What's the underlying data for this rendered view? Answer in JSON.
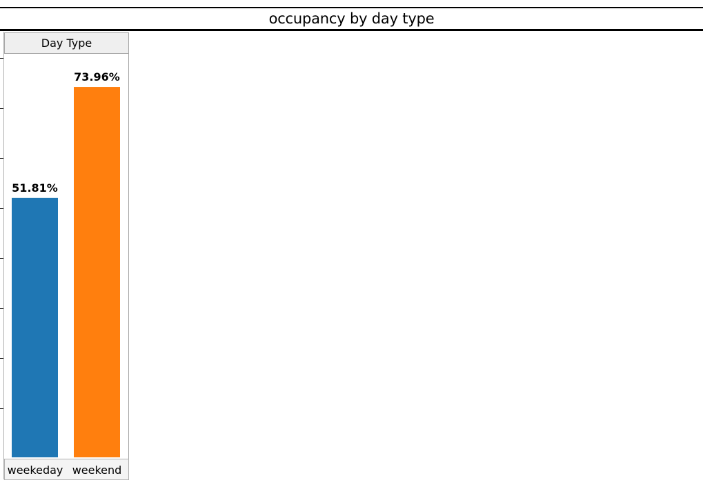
{
  "chart_data": {
    "type": "bar",
    "title": "occupancy by day type",
    "column_header": "Day Type",
    "categories": [
      "weekeday",
      "weekend"
    ],
    "values": [
      51.81,
      73.96
    ],
    "value_labels": [
      "51.81%",
      "73.96%"
    ],
    "colors": [
      "#1f77b4",
      "#ff7f0e"
    ],
    "ylim": [
      0,
      80
    ],
    "y_gridlines": false,
    "legend": "none"
  }
}
